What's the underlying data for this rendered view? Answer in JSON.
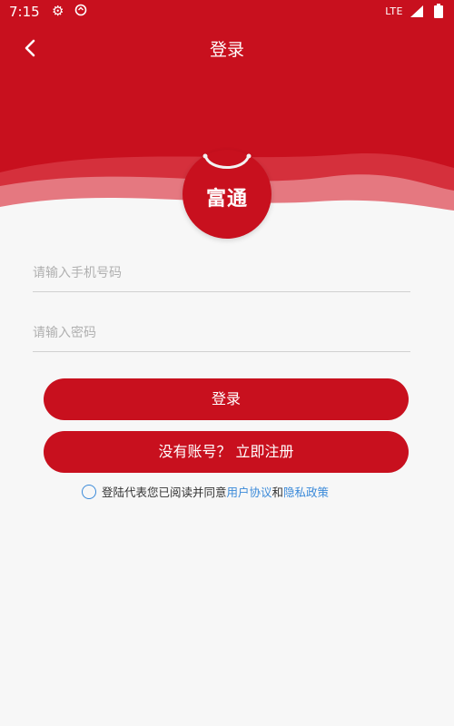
{
  "status_bar": {
    "time": "7:15",
    "network": "LTE"
  },
  "nav": {
    "title": "登录"
  },
  "logo": {
    "text": "富通"
  },
  "form": {
    "phone_placeholder": "请输入手机号码",
    "password_placeholder": "请输入密码",
    "login_label": "登录",
    "register_label": "没有账号？ 立即注册"
  },
  "agreement": {
    "prefix": "登陆代表您已阅读并同意",
    "user_agreement": "用户协议",
    "and": "和",
    "privacy_policy": "隐私政策"
  },
  "colors": {
    "brand_red": "#c8101e",
    "link_blue": "#3b8ad9",
    "background": "#f7f7f7"
  }
}
